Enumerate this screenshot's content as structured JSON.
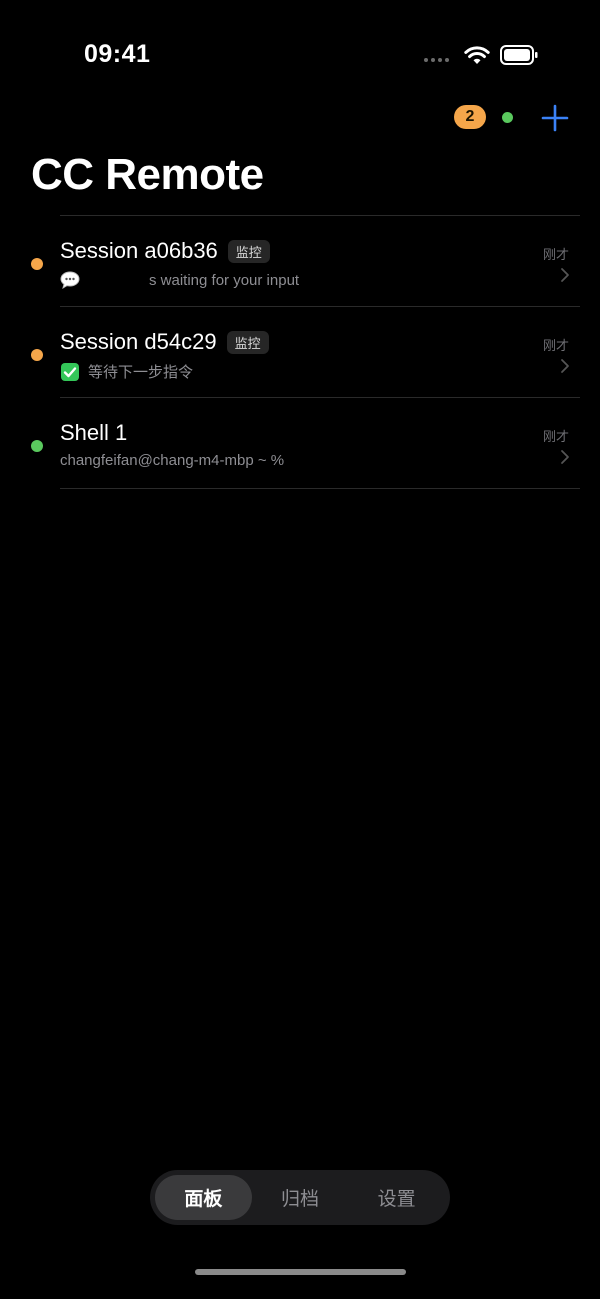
{
  "status_bar": {
    "time": "09:41"
  },
  "header": {
    "badge_count": "2",
    "connection_color": "#5ac95e",
    "add_icon": "plus-icon",
    "title": "CC Remote"
  },
  "colors": {
    "accent": "#3b82f6",
    "waiting": "#f5a64a",
    "active": "#5ac95e",
    "background": "#000000"
  },
  "sessions": [
    {
      "title": "Session a06b36",
      "tag": "监控",
      "status_color": "#f5a64a",
      "icon": "speech-bubble-icon",
      "subtitle": "s waiting for your input",
      "time": "刚才"
    },
    {
      "title": "Session d54c29",
      "tag": "监控",
      "status_color": "#f5a64a",
      "icon": "check-mark-icon",
      "subtitle": "等待下一步指令",
      "time": "刚才"
    },
    {
      "title": "Shell 1",
      "status_color": "#5ac95e",
      "subtitle": "changfeifan@chang-m4-mbp ~ %",
      "time": "刚才"
    }
  ],
  "tabs": [
    {
      "label": "面板",
      "active": true
    },
    {
      "label": "归档",
      "active": false
    },
    {
      "label": "设置",
      "active": false
    }
  ]
}
